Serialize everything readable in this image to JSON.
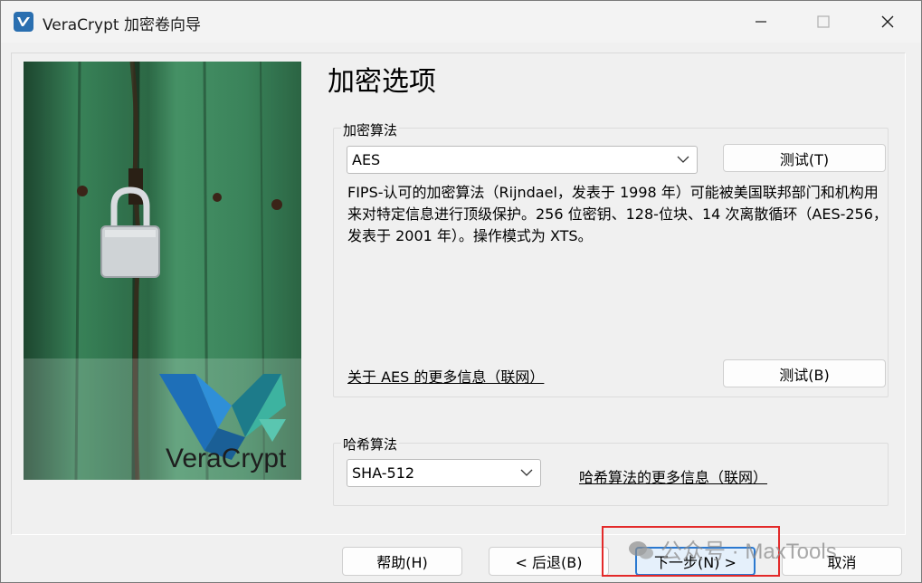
{
  "window": {
    "title": "VeraCrypt 加密卷向导"
  },
  "page": {
    "title": "加密选项"
  },
  "encryption": {
    "group_label": "加密算法",
    "selected": "AES",
    "test_label": "测试(T)",
    "description": "FIPS-认可的加密算法（Rijndael，发表于 1998 年）可能被美国联邦部门和机构用来对特定信息进行顶级保护。256 位密钥、128-位块、14 次离散循环（AES-256，发表于 2001 年）。操作模式为 XTS。",
    "more_info_link": "关于 AES 的更多信息（联网）",
    "benchmark_label": "测试(B)"
  },
  "hash": {
    "group_label": "哈希算法",
    "selected": "SHA-512",
    "more_info_link": "哈希算法的更多信息（联网）"
  },
  "buttons": {
    "help": "帮助(H)",
    "back": "< 后退(B)",
    "next": "下一步(N) >",
    "cancel": "取消"
  },
  "image": {
    "logo_text": "VeraCrypt"
  },
  "watermark": "公众号 · MaxTools",
  "colors": {
    "accent": "#2b79d0",
    "highlight": "#e32a2a",
    "door_green": "#3f8f64"
  }
}
